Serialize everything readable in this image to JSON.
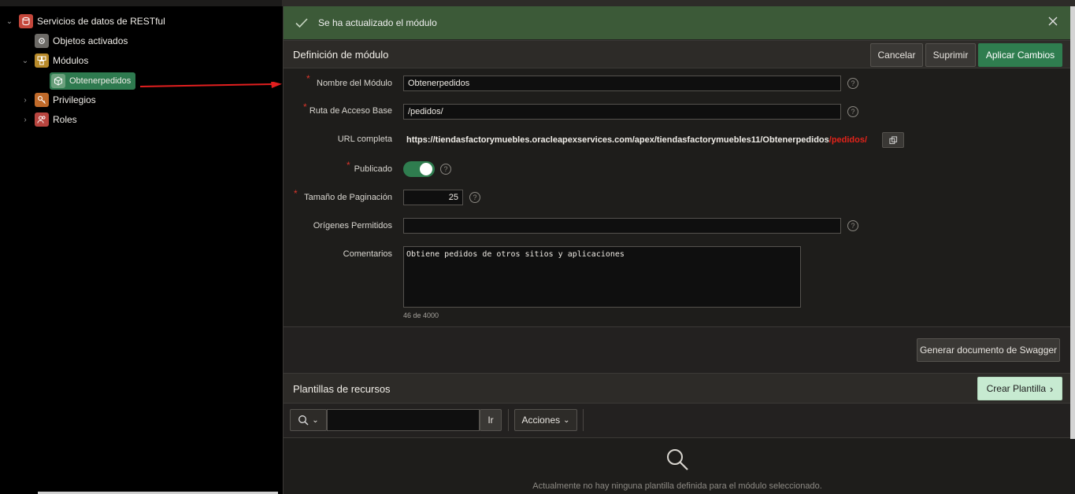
{
  "tree": {
    "root_label": "Servicios de datos de RESTful",
    "items": [
      {
        "label": "Objetos activados",
        "icon": "gear-icon"
      },
      {
        "label": "Módulos",
        "icon": "modules-icon"
      },
      {
        "label": "Obtenerpedidos",
        "icon": "cube-icon",
        "selected": true
      },
      {
        "label": "Privilegios",
        "icon": "key-icon"
      },
      {
        "label": "Roles",
        "icon": "people-icon"
      }
    ]
  },
  "alert": {
    "message": "Se ha actualizado el módulo"
  },
  "module_def": {
    "title": "Definición de módulo",
    "cancel_label": "Cancelar",
    "delete_label": "Suprimir",
    "apply_label": "Aplicar Cambios",
    "fields": {
      "name_label": "Nombre del Módulo",
      "name_value": "Obtenerpedidos",
      "base_path_label": "Ruta de Acceso Base",
      "base_path_value": "/pedidos/",
      "url_label": "URL completa",
      "url_prefix": "https://tiendasfactorymuebles.oracleapexservices.com/apex/tiendasfactorymuebles11/Obtenerpedidos",
      "url_suffix": "/pedidos/",
      "published_label": "Publicado",
      "published": true,
      "pagination_label": "Tamaño de Paginación",
      "pagination_value": "25",
      "origins_label": "Orígenes Permitidos",
      "origins_value": "",
      "comments_label": "Comentarios",
      "comments_value": "Obtiene pedidos de otros sitios y aplicaciones",
      "comments_counter": "46 de 4000"
    },
    "swagger_label": "Generar documento de Swagger"
  },
  "templates": {
    "title": "Plantillas de recursos",
    "create_label": "Crear Plantilla",
    "go_label": "Ir",
    "actions_label": "Acciones",
    "search_value": "",
    "empty_message": "Actualmente no hay ninguna plantilla definida para el módulo seleccionado."
  },
  "colors": {
    "accent_green": "#2f7d4f",
    "alert_green": "#3c5a38",
    "required_red": "#d9352b",
    "url_red": "#e2231a"
  }
}
